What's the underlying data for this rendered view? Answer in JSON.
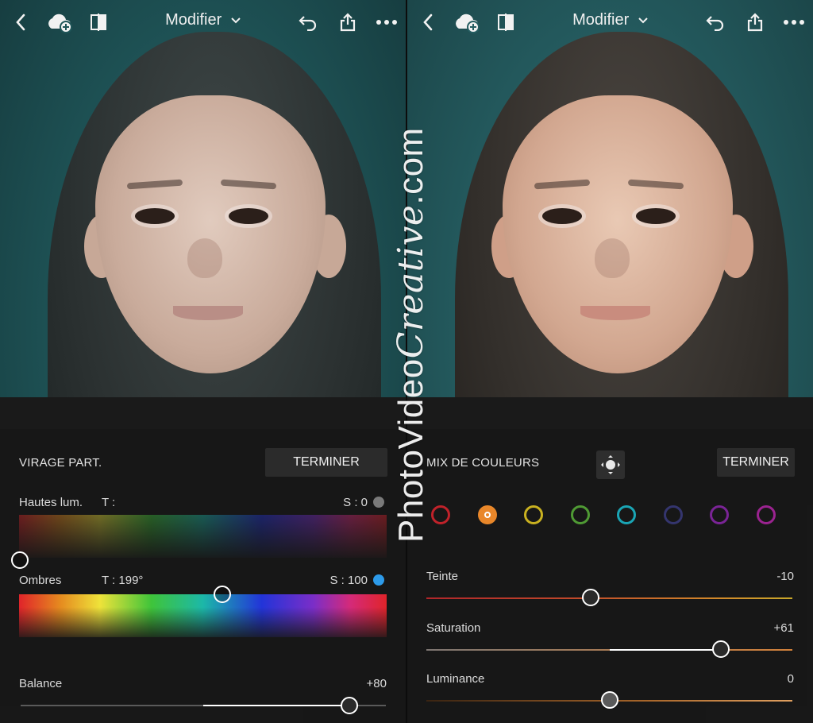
{
  "left": {
    "header": {
      "title": "Modifier"
    },
    "panel": {
      "title": "VIRAGE PART.",
      "done_label": "TERMINER",
      "highlights": {
        "label": "Hautes lum.",
        "hue_label": "T :",
        "sat_label": "S : 0",
        "dot_color": "#7a7a7a"
      },
      "shadows": {
        "label": "Ombres",
        "hue_label": "T : 199°",
        "sat_label": "S : 100",
        "dot_color": "#2d9bea",
        "hue": 199
      },
      "balance": {
        "label": "Balance",
        "value_label": "+80",
        "value": 80
      }
    }
  },
  "right": {
    "header": {
      "title": "Modifier"
    },
    "panel": {
      "title": "MIX DE COULEURS",
      "done_label": "TERMINER",
      "swatches": [
        {
          "name": "red",
          "color": "#c0222a"
        },
        {
          "name": "orange",
          "color": "#e9872a",
          "selected": true
        },
        {
          "name": "yellow",
          "color": "#c9b120"
        },
        {
          "name": "green",
          "color": "#4f9a34"
        },
        {
          "name": "aqua",
          "color": "#1aa5b5"
        },
        {
          "name": "blue",
          "color": "#34356e"
        },
        {
          "name": "purple",
          "color": "#7a2496"
        },
        {
          "name": "magenta",
          "color": "#9b2390"
        }
      ],
      "sliders": [
        {
          "key": "hue",
          "label": "Teinte",
          "value_label": "-10",
          "value": -10
        },
        {
          "key": "saturation",
          "label": "Saturation",
          "value_label": "+61",
          "value": 61
        },
        {
          "key": "luminance",
          "label": "Luminance",
          "value_label": "0",
          "value": 0
        }
      ]
    }
  },
  "watermark": {
    "part1": "PhotoVideo",
    "part2": "Creative",
    "part3": ".com"
  }
}
